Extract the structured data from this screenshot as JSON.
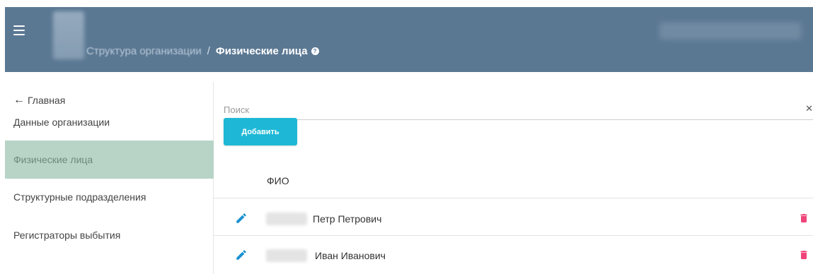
{
  "header": {
    "breadcrumb_parent": "Структура организации",
    "separator": "/",
    "title": "Физические лица",
    "help_icon": "question-circle-icon",
    "background": "#5b7893"
  },
  "sidebar": {
    "back_label": "Главная",
    "items": [
      {
        "label": "Данные организации"
      },
      {
        "label": "Физические лица",
        "active": true
      },
      {
        "label": "Структурные подразделения"
      },
      {
        "label": "Регистраторы выбытия"
      }
    ],
    "active_color": "#b7d4c6"
  },
  "search": {
    "placeholder": "Поиск",
    "value": "",
    "clear_icon": "close-icon"
  },
  "toolbar": {
    "add_label": "Добавить",
    "add_color": "#1eb8d6"
  },
  "table": {
    "columns": [
      "ФИО"
    ],
    "rows": [
      {
        "name": "Петр Петрович"
      },
      {
        "name": "Иван Иванович"
      }
    ],
    "edit_icon": "pencil-icon",
    "delete_icon": "trash-icon",
    "edit_color": "#1a91d0",
    "delete_color": "#f0457a"
  }
}
